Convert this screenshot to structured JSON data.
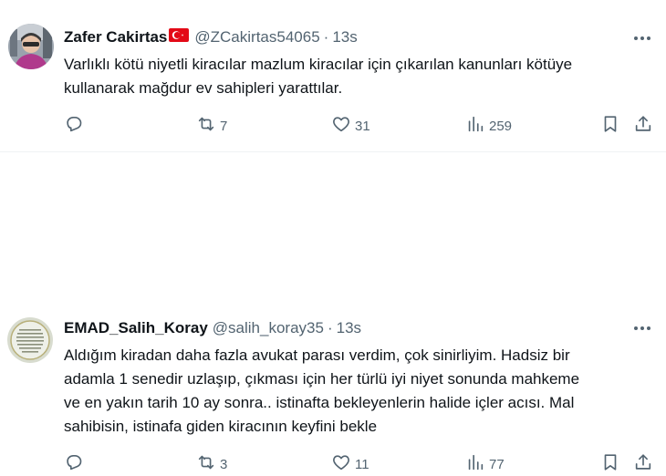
{
  "tweets": [
    {
      "display_name": "Zafer Cakirtas",
      "flag": "turkey-flag",
      "handle": "@ZCakirtas54065",
      "separator": "·",
      "time": "13s",
      "text": "Varlıklı kötü niyetli kiracılar mazlum kiracılar için çıkarılan kanunları kötüye\nkullanarak mağdur ev sahipleri yarattılar.",
      "actions": {
        "replies": "",
        "reposts": "7",
        "likes": "31",
        "views": "259"
      }
    },
    {
      "display_name": "EMAD_Salih_Koray",
      "handle": "@salih_koray35",
      "separator": "·",
      "time": "13s",
      "text": "Aldığım kiradan daha fazla avukat parası verdim, çok sinirliyim. Hadsiz bir\nadamla 1 senedir uzlaşıp, çıkması için her türlü iyi niyet sonunda mahkeme\nve en yakın tarih 10 ay sonra.. istinafta bekleyenlerin halide içler acısı. Mal\nsahibisin, istinafa giden kiracının keyfini bekle",
      "actions": {
        "replies": "",
        "reposts": "3",
        "likes": "11",
        "views": "77"
      }
    }
  ],
  "icons": {
    "reply": "reply-icon",
    "repost": "repost-icon",
    "like": "heart-icon",
    "views": "views-icon",
    "bookmark": "bookmark-icon",
    "share": "share-icon",
    "more": "more-icon"
  },
  "colors": {
    "text": "#0f1419",
    "secondary": "#536471",
    "divider": "#eff3f4",
    "flag_red": "#e30a17"
  }
}
